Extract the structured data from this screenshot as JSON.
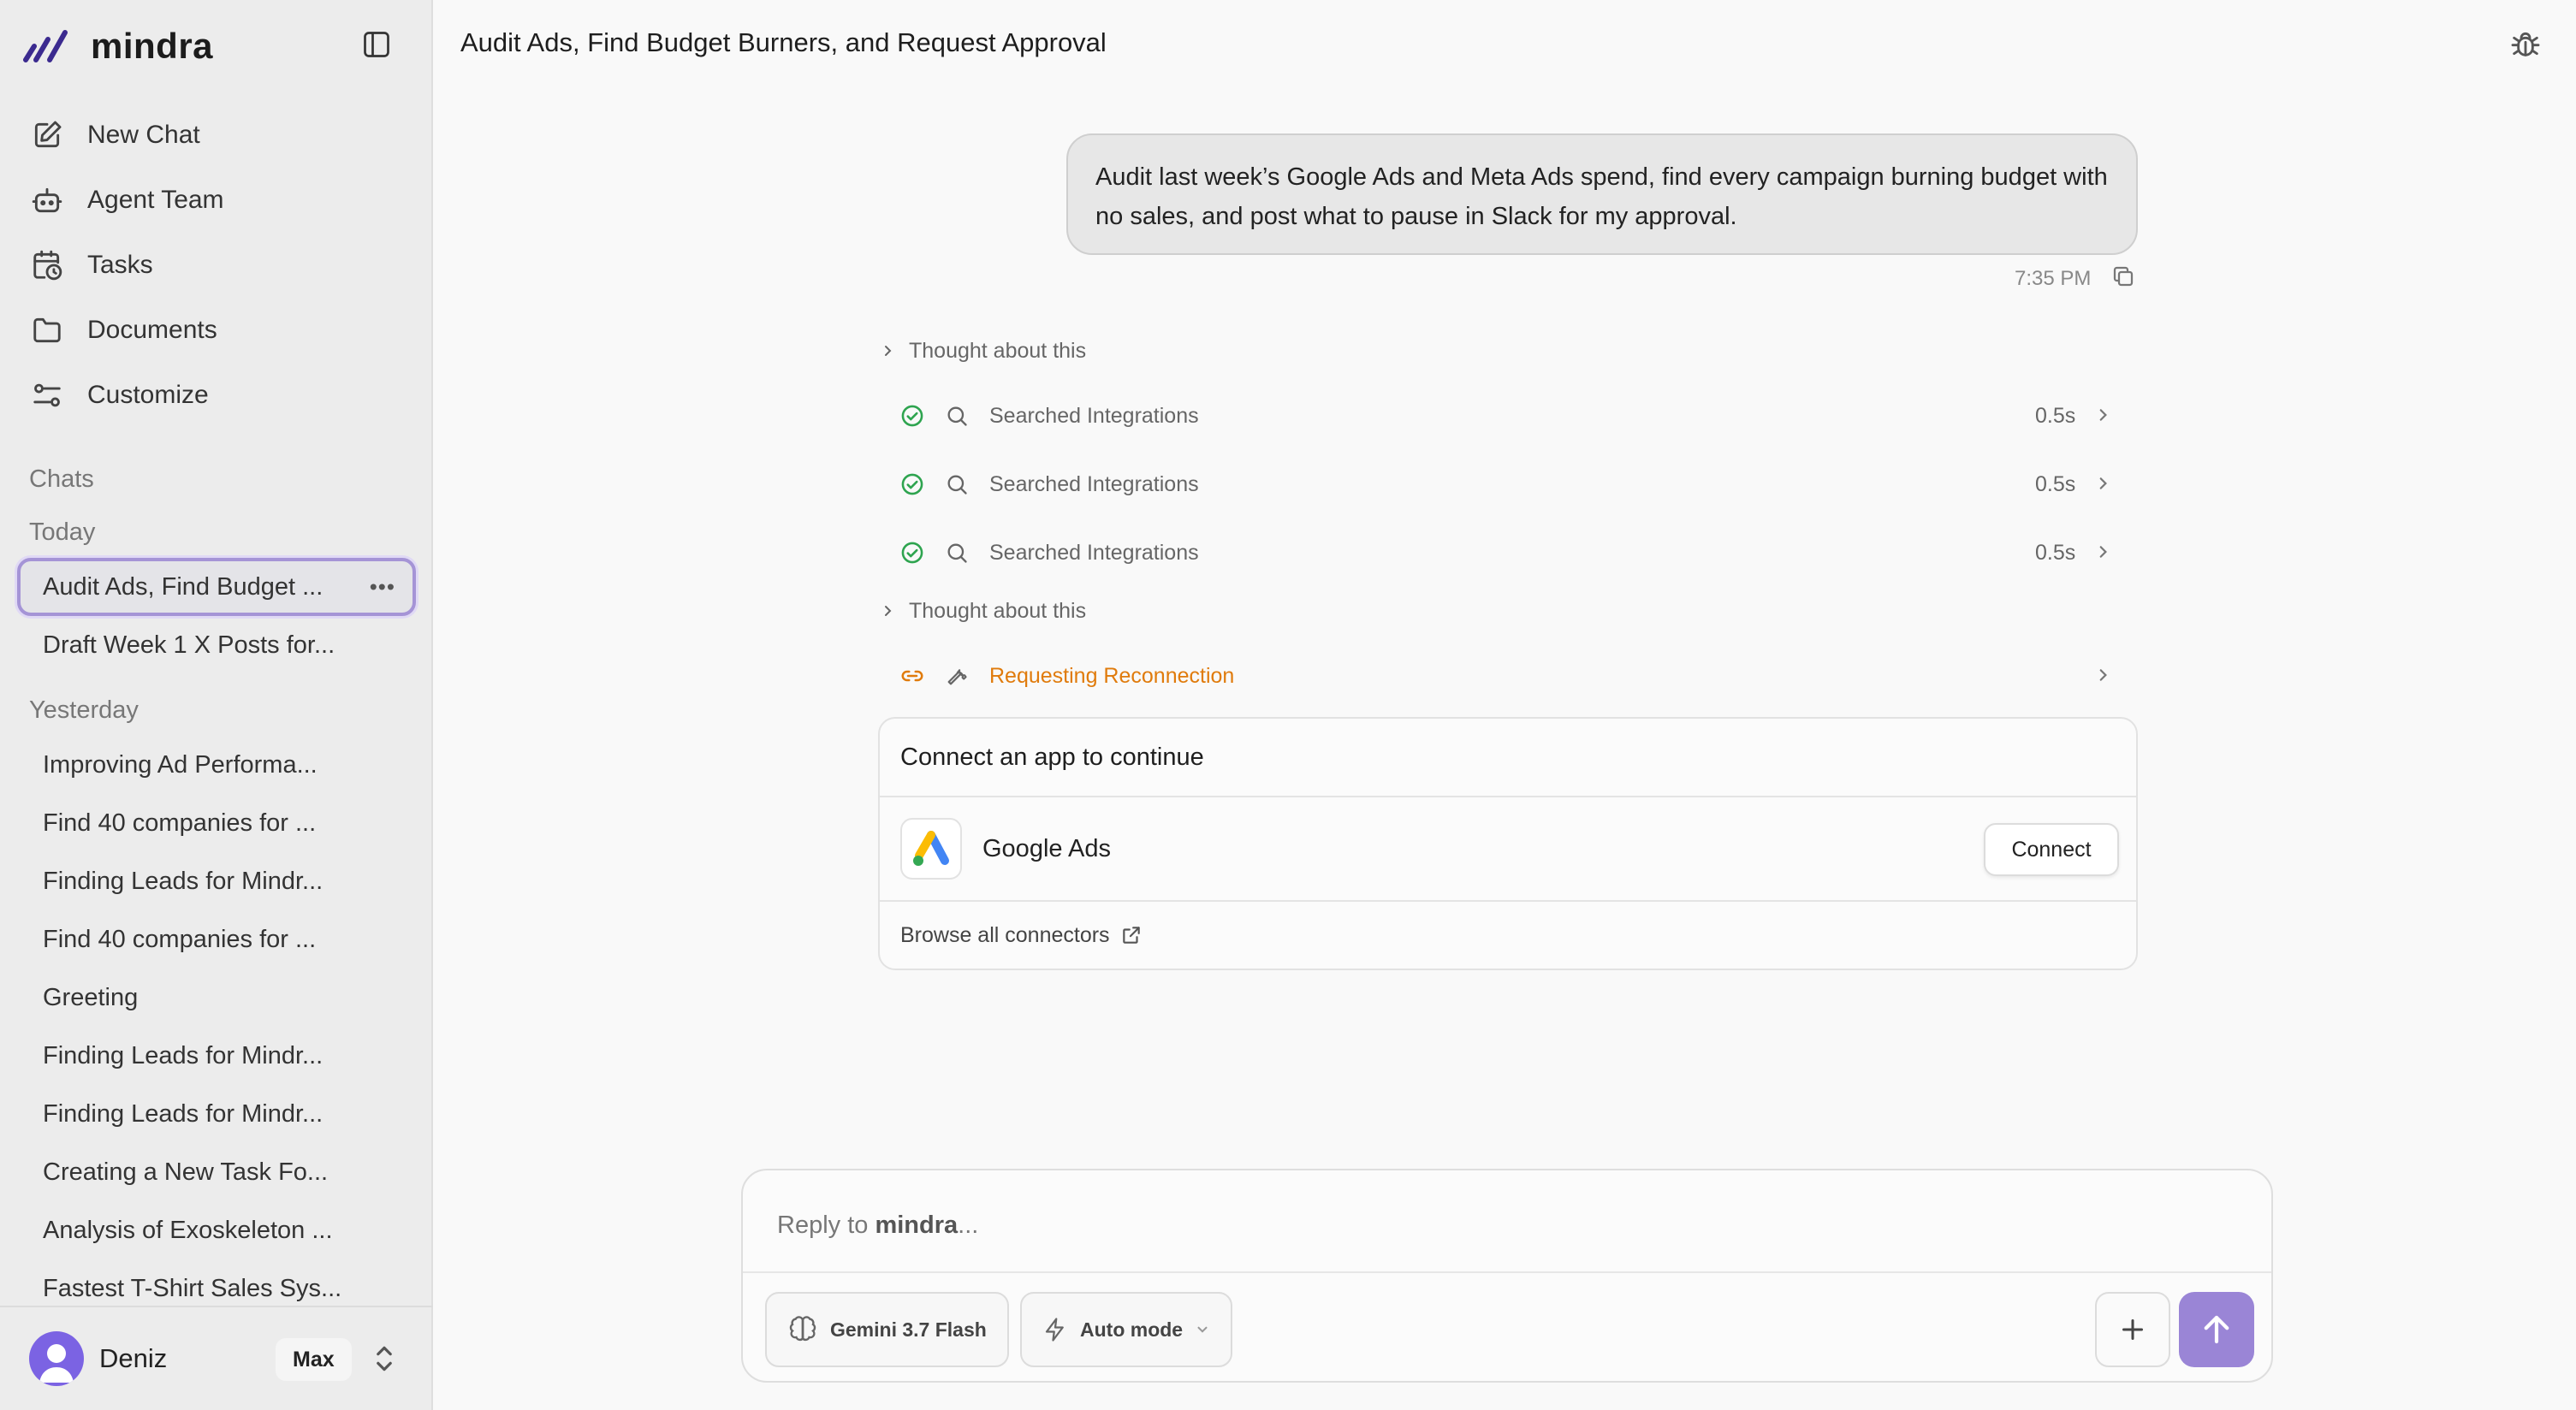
{
  "brand": {
    "name": "mindra"
  },
  "nav": [
    {
      "label": "New Chat",
      "icon": "edit-icon"
    },
    {
      "label": "Agent Team",
      "icon": "robot-icon"
    },
    {
      "label": "Tasks",
      "icon": "calendar-clock-icon"
    },
    {
      "label": "Documents",
      "icon": "folder-icon"
    },
    {
      "label": "Customize",
      "icon": "sliders-icon"
    }
  ],
  "sections": {
    "chats": "Chats",
    "today": "Today",
    "yesterday": "Yesterday"
  },
  "chats_today": [
    {
      "title": "Audit Ads, Find Budget ...",
      "active": true
    },
    {
      "title": "Draft Week 1 X Posts for..."
    }
  ],
  "chats_yesterday": [
    "Improving Ad Performa...",
    "Find 40 companies for ...",
    "Finding Leads for Mindr...",
    "Find 40 companies for ...",
    "Greeting",
    "Finding Leads for Mindr...",
    "Finding Leads for Mindr...",
    "Creating a New Task Fo...",
    "Analysis of Exoskeleton ...",
    "Fastest T-Shirt Sales Sys..."
  ],
  "user": {
    "name": "Deniz",
    "plan": "Max"
  },
  "header": {
    "title": "Audit Ads, Find Budget Burners, and Request Approval"
  },
  "message": {
    "text": "Audit last week’s Google Ads and Meta Ads spend, find every campaign burning budget with no sales, and post what to pause in Slack for my approval.",
    "time": "7:35 PM"
  },
  "steps": {
    "thought1": "Thought about this",
    "search": [
      {
        "label": "Searched Integrations",
        "duration": "0.5s"
      },
      {
        "label": "Searched Integrations",
        "duration": "0.5s"
      },
      {
        "label": "Searched Integrations",
        "duration": "0.5s"
      }
    ],
    "thought2": "Thought about this",
    "reconnect": "Requesting Reconnection"
  },
  "connect_card": {
    "heading": "Connect an app to continue",
    "app_name": "Google Ads",
    "button": "Connect",
    "browse": "Browse all connectors"
  },
  "composer": {
    "placeholder_prefix": "Reply to ",
    "placeholder_bold": "mindra",
    "placeholder_suffix": "...",
    "model": "Gemini 3.7 Flash",
    "mode": "Auto mode"
  },
  "colors": {
    "accent": "#9a85d6",
    "active_border": "#a594d6",
    "success": "#2ea44f",
    "warning": "#e07b0c",
    "logo": "#3b2a8f"
  }
}
